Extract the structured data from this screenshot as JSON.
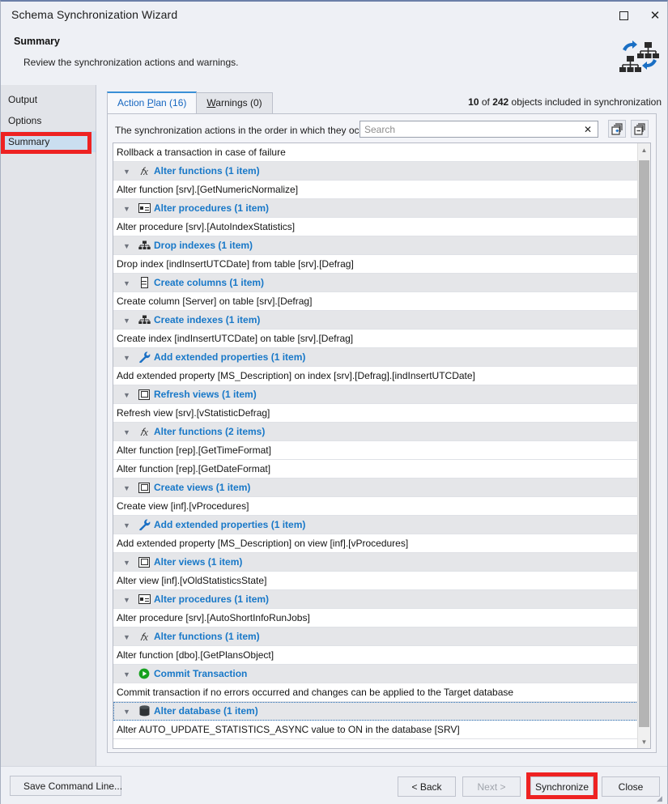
{
  "window": {
    "title": "Schema Synchronization Wizard",
    "maximize_icon": "maximize-icon",
    "close_icon": "close-icon"
  },
  "header": {
    "title": "Summary",
    "subtitle": "Review the synchronization actions and warnings.",
    "icon": "schema-sync-icon"
  },
  "sidebar": {
    "items": [
      {
        "label": "Output",
        "selected": false
      },
      {
        "label": "Options",
        "selected": false
      },
      {
        "label": "Summary",
        "selected": true
      }
    ]
  },
  "main": {
    "tabs": [
      {
        "label": "Action Plan (16)",
        "accel": "P",
        "active": true
      },
      {
        "label": "Warnings (0)",
        "accel": "W",
        "active": false
      }
    ],
    "object_count": {
      "included": "10",
      "mid": " of ",
      "total": "242",
      "suffix": " objects included in synchronization"
    },
    "panel_label": "The synchronization actions in the order in which they occur.",
    "search": {
      "value": "",
      "placeholder": "Search",
      "clear_icon": "clear-icon"
    },
    "expand_all_icon": "expand-all-icon",
    "collapse_all_icon": "collapse-all-icon",
    "rows": [
      {
        "kind": "item",
        "text": "Rollback a transaction in case of failure"
      },
      {
        "kind": "group",
        "icon": "function-icon",
        "text": "Alter functions (1 item)"
      },
      {
        "kind": "item",
        "text": "Alter function [srv].[GetNumericNormalize]"
      },
      {
        "kind": "group",
        "icon": "procedure-icon",
        "text": "Alter procedures (1 item)"
      },
      {
        "kind": "item",
        "text": "Alter procedure [srv].[AutoIndexStatistics]"
      },
      {
        "kind": "group",
        "icon": "index-icon",
        "text": "Drop indexes (1 item)"
      },
      {
        "kind": "item",
        "text": "Drop index [indInsertUTCDate] from table [srv].[Defrag]"
      },
      {
        "kind": "group",
        "icon": "column-icon",
        "text": "Create columns (1 item)"
      },
      {
        "kind": "item",
        "text": "Create column [Server] on table [srv].[Defrag]"
      },
      {
        "kind": "group",
        "icon": "index-icon",
        "text": "Create indexes (1 item)"
      },
      {
        "kind": "item",
        "text": "Create index [indInsertUTCDate] on table [srv].[Defrag]"
      },
      {
        "kind": "group",
        "icon": "wrench-icon",
        "text": "Add extended properties (1 item)"
      },
      {
        "kind": "item",
        "text": "Add extended property [MS_Description] on index [srv].[Defrag].[indInsertUTCDate]"
      },
      {
        "kind": "group",
        "icon": "view-icon",
        "text": "Refresh views (1 item)"
      },
      {
        "kind": "item",
        "text": "Refresh view [srv].[vStatisticDefrag]"
      },
      {
        "kind": "group",
        "icon": "function-icon",
        "text": "Alter functions (2 items)"
      },
      {
        "kind": "item",
        "text": "Alter function [rep].[GetTimeFormat]"
      },
      {
        "kind": "item",
        "text": "Alter function [rep].[GetDateFormat]"
      },
      {
        "kind": "group",
        "icon": "view-icon",
        "text": "Create views (1 item)"
      },
      {
        "kind": "item",
        "text": "Create view [inf].[vProcedures]"
      },
      {
        "kind": "group",
        "icon": "wrench-icon",
        "text": "Add extended properties (1 item)"
      },
      {
        "kind": "item",
        "text": "Add extended property [MS_Description] on view [inf].[vProcedures]"
      },
      {
        "kind": "group",
        "icon": "view-icon",
        "text": "Alter views (1 item)"
      },
      {
        "kind": "item",
        "text": "Alter view [inf].[vOldStatisticsState]"
      },
      {
        "kind": "group",
        "icon": "procedure-icon",
        "text": "Alter procedures (1 item)"
      },
      {
        "kind": "item",
        "text": "Alter procedure [srv].[AutoShortInfoRunJobs]"
      },
      {
        "kind": "group",
        "icon": "function-icon",
        "text": "Alter functions (1 item)"
      },
      {
        "kind": "item",
        "text": "Alter function [dbo].[GetPlansObject]"
      },
      {
        "kind": "group",
        "icon": "commit-icon",
        "text": "Commit Transaction"
      },
      {
        "kind": "item",
        "text": "Commit transaction if no errors occurred and changes can be applied to the Target database"
      },
      {
        "kind": "group",
        "icon": "database-icon",
        "text": "Alter database (1 item)",
        "focused": true
      },
      {
        "kind": "item",
        "text": "Alter AUTO_UPDATE_STATISTICS_ASYNC value to ON in the database [SRV]"
      }
    ]
  },
  "footer": {
    "save_command_line": "Save Command Line...",
    "save_icon": "save-icon",
    "back": "< Back",
    "next": "Next >",
    "synchronize": "Synchronize",
    "close": "Close"
  },
  "colors": {
    "accent_blue": "#1878c8",
    "tab_active_text": "#1566c0",
    "annotation_red": "#ee2222",
    "commit_green": "#16a11e",
    "selection_blue": "#cadef0"
  }
}
